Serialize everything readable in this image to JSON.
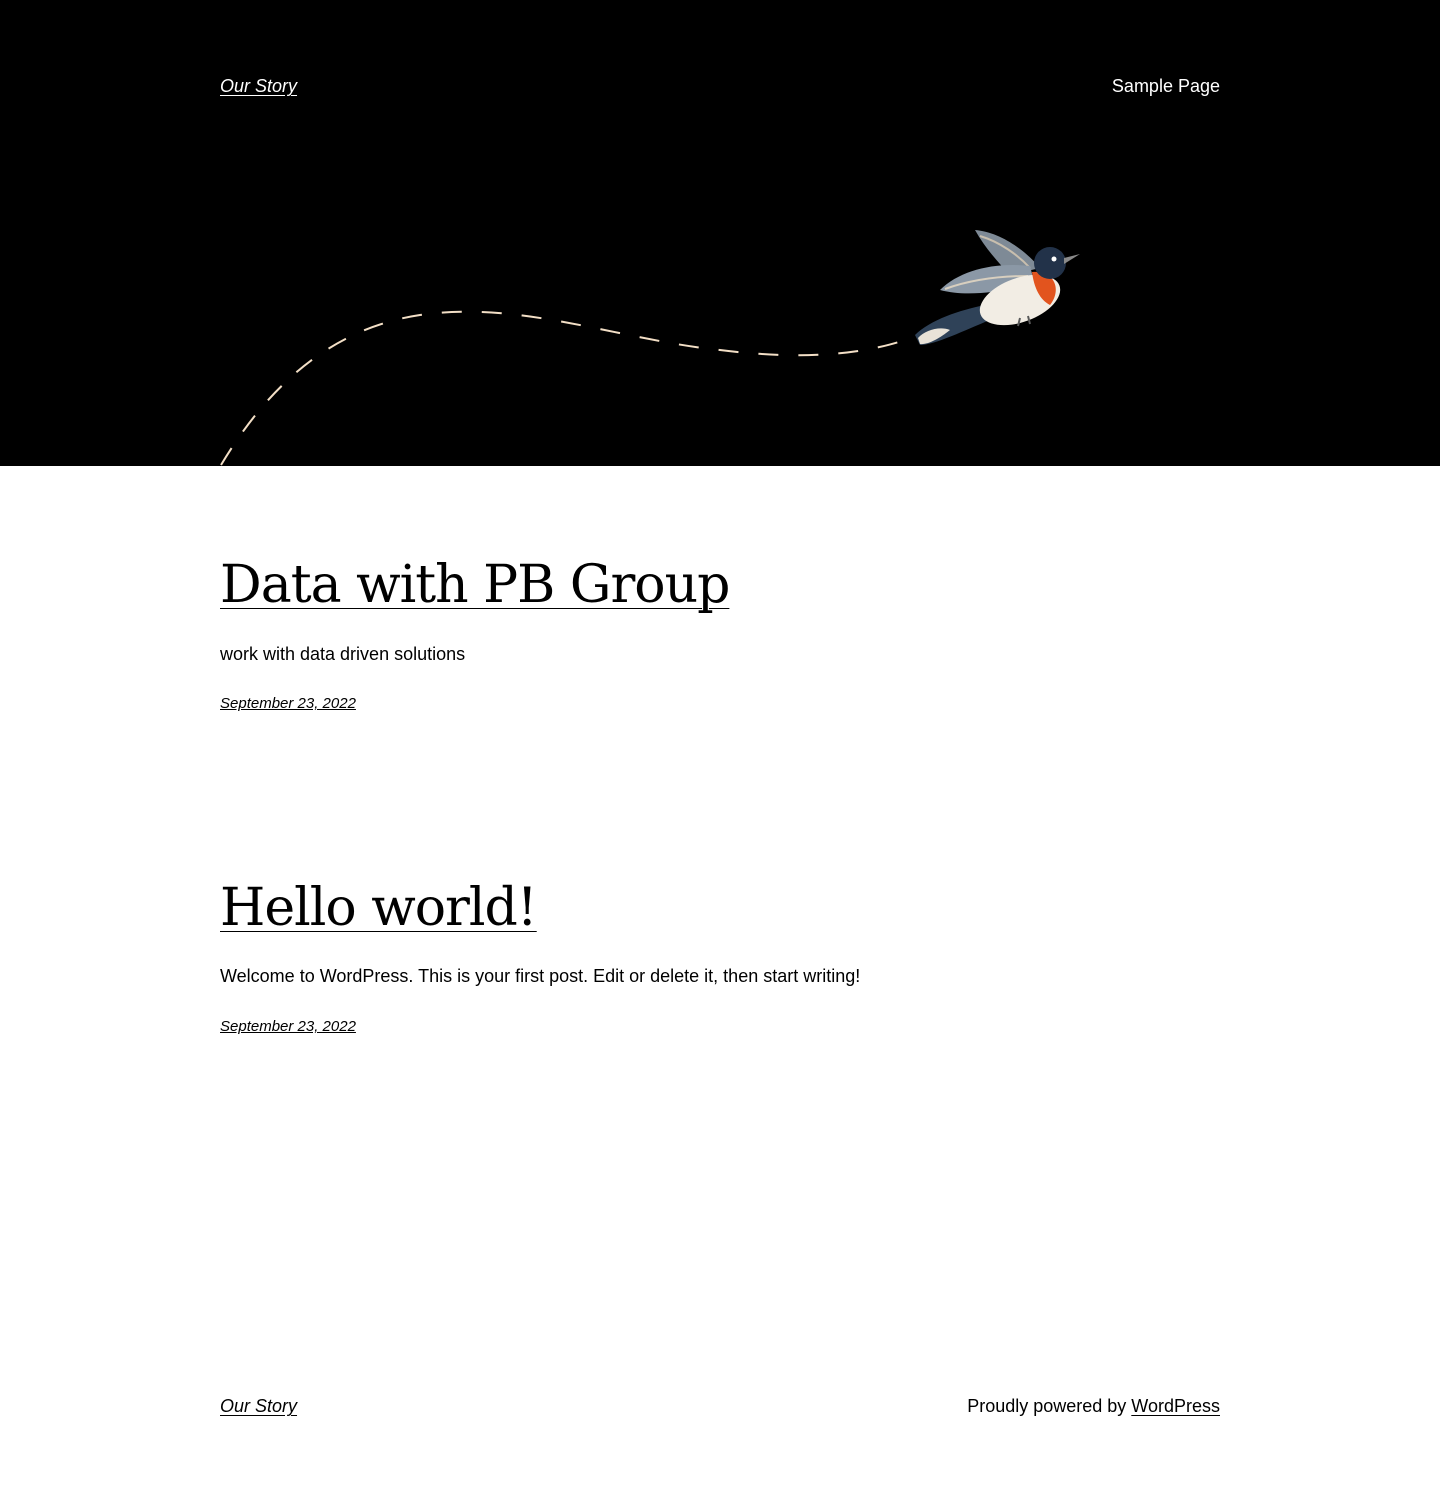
{
  "header": {
    "site_title": "Our Story",
    "nav": [
      {
        "label": "Sample Page"
      }
    ]
  },
  "posts": [
    {
      "title": "Data with PB Group",
      "excerpt": "work with data driven solutions",
      "date": "September 23, 2022"
    },
    {
      "title": "Hello world!",
      "excerpt": "Welcome to WordPress. This is your first post. Edit or delete it, then start writing!",
      "date": "September 23, 2022"
    }
  ],
  "footer": {
    "site_title": "Our Story",
    "credit_prefix": "Proudly powered by ",
    "credit_link": "WordPress"
  },
  "colors": {
    "header_background": "#000000",
    "page_background": "#ffffff",
    "flight_path": "#f3dfc6",
    "bird_breast": "#e2541e"
  }
}
